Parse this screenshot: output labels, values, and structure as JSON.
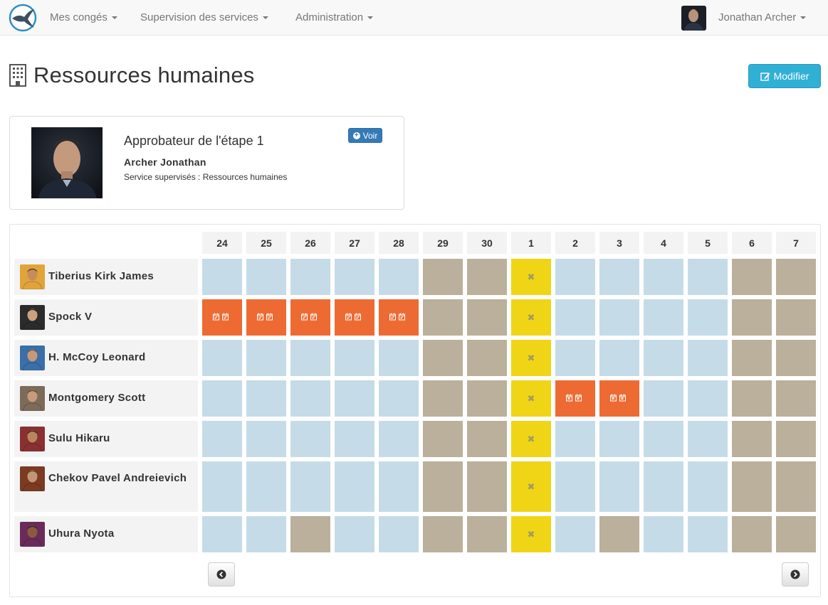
{
  "nav": {
    "items": [
      {
        "label": "Mes congés",
        "name": "nav-mes-conges"
      },
      {
        "label": "Supervision des services",
        "name": "nav-supervision"
      },
      {
        "label": "Administration",
        "name": "nav-administration"
      }
    ],
    "user": "Jonathan Archer"
  },
  "header": {
    "title": "Ressources humaines",
    "modify_label": "Modifier"
  },
  "approver": {
    "heading": "Approbateur de l'étape 1",
    "name": "Archer Jonathan",
    "service": "Service supervisés : Ressources humaines",
    "voir_label": "Voir"
  },
  "calendar": {
    "days": [
      "24",
      "25",
      "26",
      "27",
      "28",
      "29",
      "30",
      "1",
      "2",
      "3",
      "4",
      "5",
      "6",
      "7"
    ],
    "legend_colors": {
      "working": "#c5dce8",
      "weekend": "#bab09b",
      "holiday": "#f0d517",
      "leave": "#ed6b33"
    },
    "employees": [
      {
        "name": "Tiberius Kirk James",
        "status": [
          "w",
          "w",
          "w",
          "w",
          "w",
          "e",
          "e",
          "h",
          "w",
          "w",
          "w",
          "w",
          "e",
          "e"
        ]
      },
      {
        "name": "Spock V",
        "status": [
          "a",
          "a",
          "a",
          "a",
          "a",
          "e",
          "e",
          "h",
          "w",
          "w",
          "w",
          "w",
          "e",
          "e"
        ]
      },
      {
        "name": "H. McCoy Leonard",
        "status": [
          "w",
          "w",
          "w",
          "w",
          "w",
          "e",
          "e",
          "h",
          "w",
          "w",
          "w",
          "w",
          "e",
          "e"
        ]
      },
      {
        "name": "Montgomery Scott",
        "status": [
          "w",
          "w",
          "w",
          "w",
          "w",
          "e",
          "e",
          "h",
          "r",
          "r",
          "w",
          "w",
          "e",
          "e"
        ]
      },
      {
        "name": "Sulu Hikaru",
        "status": [
          "w",
          "w",
          "w",
          "w",
          "w",
          "e",
          "e",
          "h",
          "w",
          "w",
          "w",
          "w",
          "e",
          "e"
        ]
      },
      {
        "name": "Chekov Pavel Andreievich",
        "status": [
          "w",
          "w",
          "w",
          "w",
          "w",
          "e",
          "e",
          "h",
          "w",
          "w",
          "w",
          "w",
          "e",
          "e"
        ]
      },
      {
        "name": "Uhura Nyota",
        "status": [
          "w",
          "w",
          "e",
          "w",
          "w",
          "e",
          "e",
          "h",
          "w",
          "e",
          "w",
          "w",
          "e",
          "e"
        ]
      }
    ]
  }
}
